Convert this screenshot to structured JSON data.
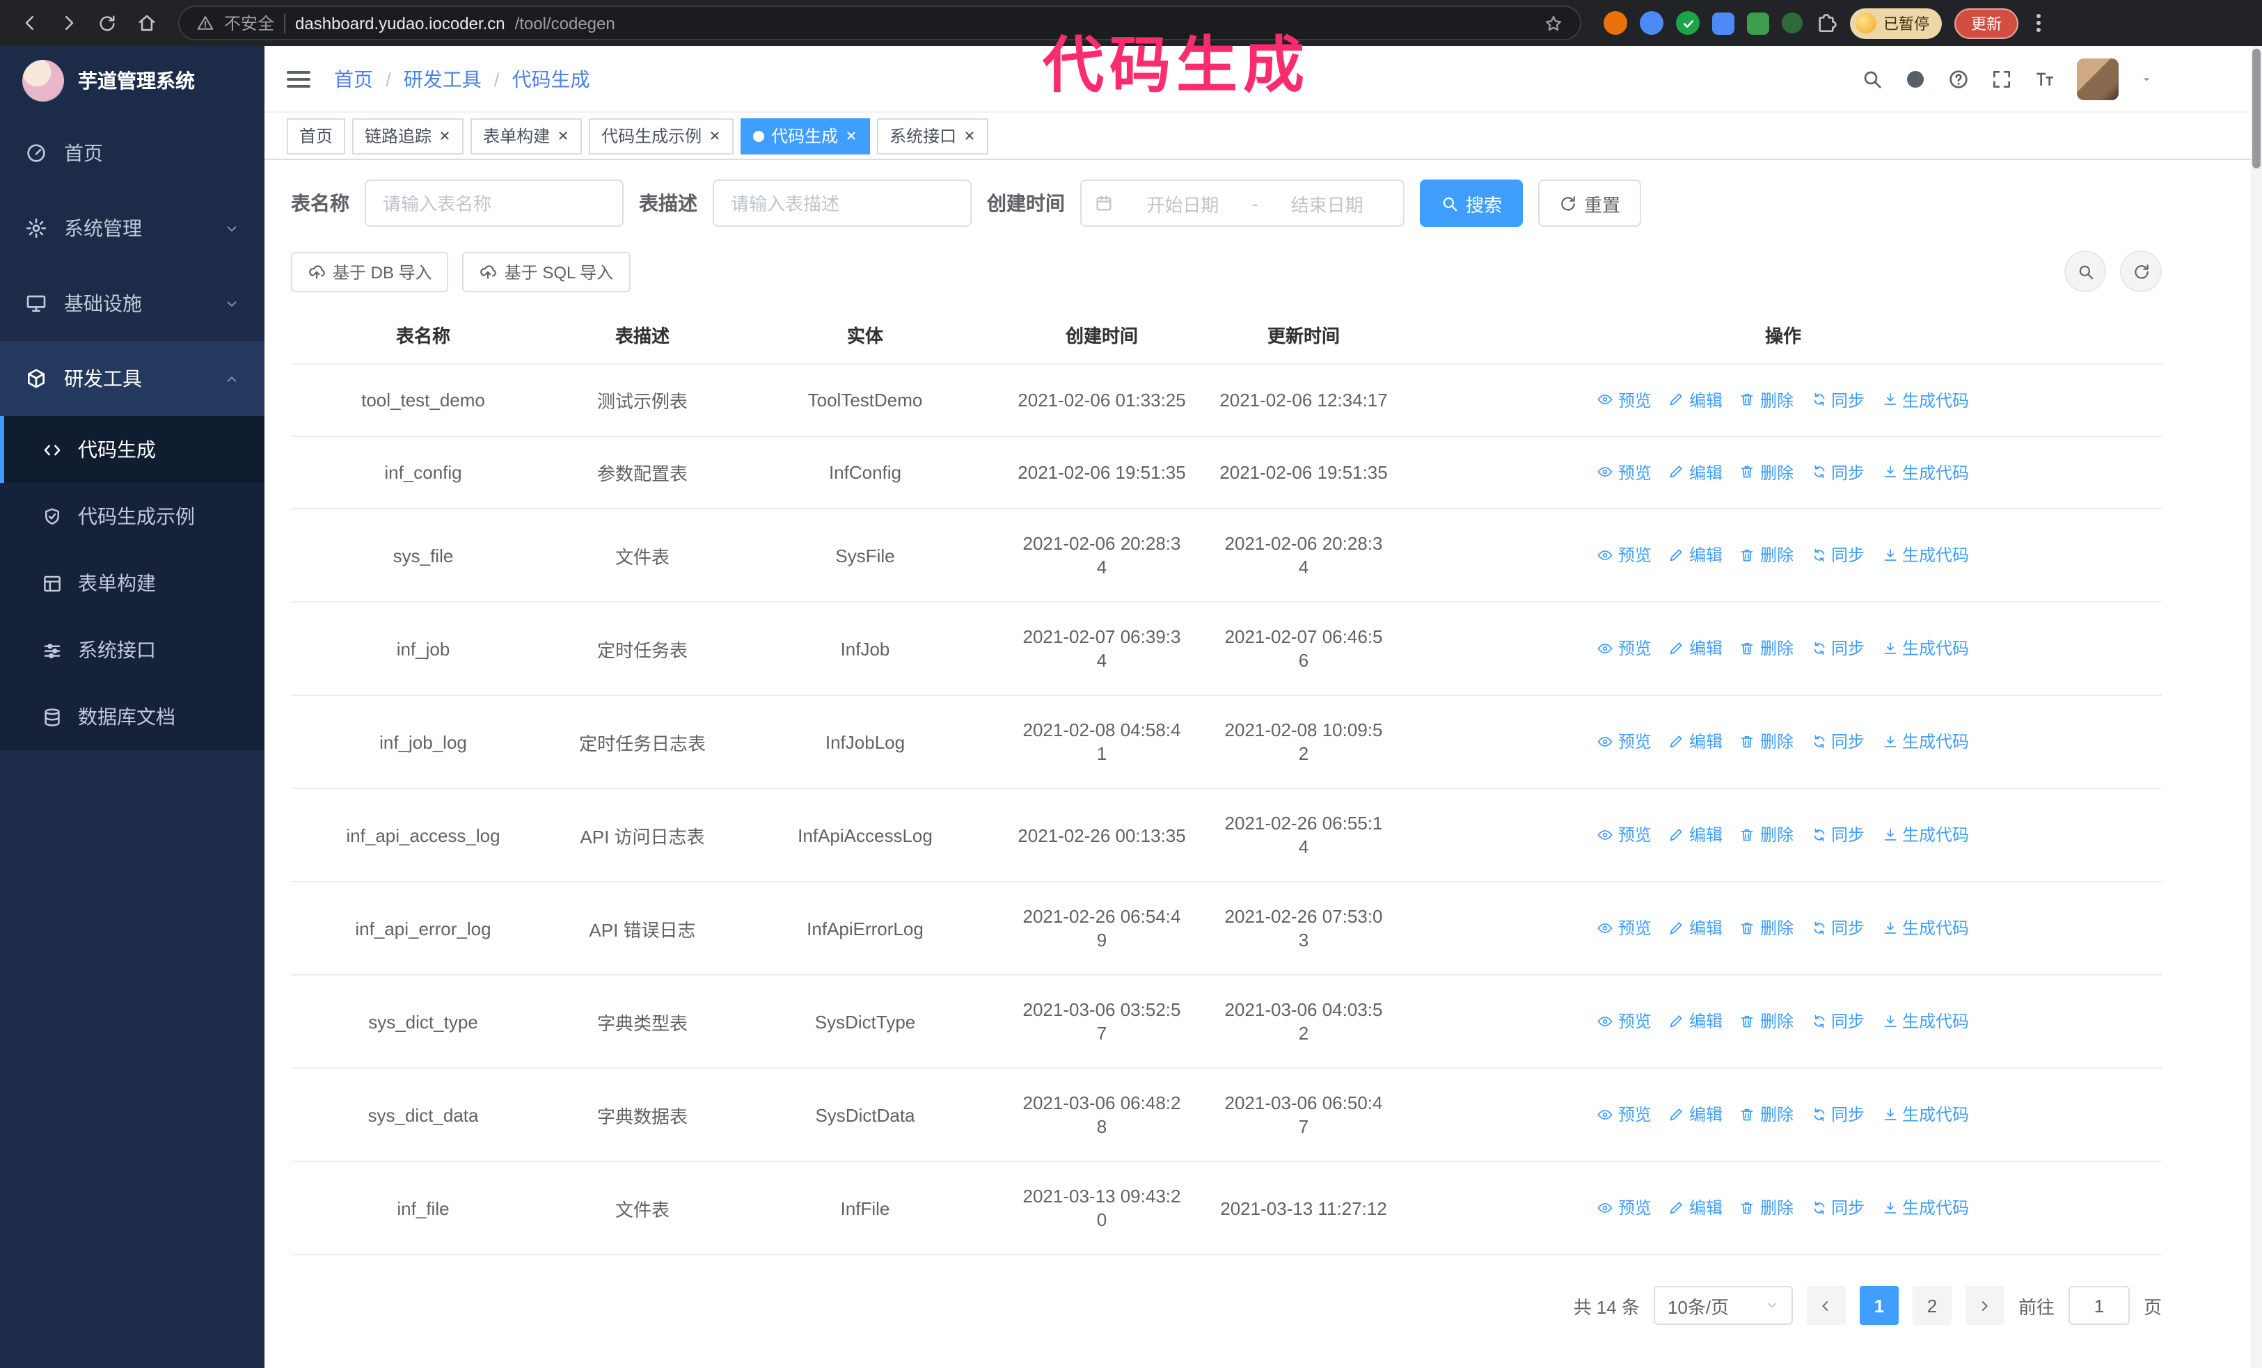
{
  "browser": {
    "security_label": "不安全",
    "url_host": "dashboard.yudao.iocoder.cn",
    "url_path": "/tool/codegen",
    "profile_chip": "已暂停",
    "update_button": "更新"
  },
  "annotation": {
    "text": "代码生成"
  },
  "colors": {
    "accent": "#409eff",
    "annotation_pink": "#fa2c6e",
    "sidebar_bg": "#1c2b48",
    "active_tab": "#409eff"
  },
  "sidebar": {
    "title": "芋道管理系统",
    "items": [
      {
        "label": "首页"
      },
      {
        "label": "系统管理"
      },
      {
        "label": "基础设施"
      },
      {
        "label": "研发工具"
      }
    ],
    "subitems": [
      {
        "label": "代码生成"
      },
      {
        "label": "代码生成示例"
      },
      {
        "label": "表单构建"
      },
      {
        "label": "系统接口"
      },
      {
        "label": "数据库文档"
      }
    ]
  },
  "header": {
    "breadcrumb": [
      "首页",
      "研发工具",
      "代码生成"
    ],
    "separator": "/"
  },
  "tabs": [
    {
      "label": "首页",
      "active": false,
      "closable": false
    },
    {
      "label": "链路追踪",
      "active": false,
      "closable": true
    },
    {
      "label": "表单构建",
      "active": false,
      "closable": true
    },
    {
      "label": "代码生成示例",
      "active": false,
      "closable": true
    },
    {
      "label": "代码生成",
      "active": true,
      "closable": true
    },
    {
      "label": "系统接口",
      "active": false,
      "closable": true
    }
  ],
  "filters": {
    "table_name_label": "表名称",
    "table_name_placeholder": "请输入表名称",
    "table_desc_label": "表描述",
    "table_desc_placeholder": "请输入表描述",
    "create_time_label": "创建时间",
    "start_date_placeholder": "开始日期",
    "range_separator": "-",
    "end_date_placeholder": "结束日期",
    "search_button": "搜索",
    "reset_button": "重置"
  },
  "toolbar": {
    "import_db": "基于 DB 导入",
    "import_sql": "基于 SQL 导入"
  },
  "table": {
    "columns": [
      "表名称",
      "表描述",
      "实体",
      "创建时间",
      "更新时间",
      "操作"
    ],
    "actions": [
      "预览",
      "编辑",
      "删除",
      "同步",
      "生成代码"
    ],
    "rows": [
      {
        "name": "tool_test_demo",
        "desc": "测试示例表",
        "entity": "ToolTestDemo",
        "created": "2021-02-06 01:33:25",
        "updated": "2021-02-06 12:34:17"
      },
      {
        "name": "inf_config",
        "desc": "参数配置表",
        "entity": "InfConfig",
        "created": "2021-02-06 19:51:35",
        "updated": "2021-02-06 19:51:35"
      },
      {
        "name": "sys_file",
        "desc": "文件表",
        "entity": "SysFile",
        "created": "2021-02-06 20:28:3\n4",
        "updated": "2021-02-06 20:28:3\n4"
      },
      {
        "name": "inf_job",
        "desc": "定时任务表",
        "entity": "InfJob",
        "created": "2021-02-07 06:39:3\n4",
        "updated": "2021-02-07 06:46:5\n6"
      },
      {
        "name": "inf_job_log",
        "desc": "定时任务日志表",
        "entity": "InfJobLog",
        "created": "2021-02-08 04:58:4\n1",
        "updated": "2021-02-08 10:09:5\n2"
      },
      {
        "name": "inf_api_access_log",
        "desc": "API 访问日志表",
        "entity": "InfApiAccessLog",
        "created": "2021-02-26 00:13:35",
        "updated": "2021-02-26 06:55:1\n4"
      },
      {
        "name": "inf_api_error_log",
        "desc": "API 错误日志",
        "entity": "InfApiErrorLog",
        "created": "2021-02-26 06:54:4\n9",
        "updated": "2021-02-26 07:53:0\n3"
      },
      {
        "name": "sys_dict_type",
        "desc": "字典类型表",
        "entity": "SysDictType",
        "created": "2021-03-06 03:52:5\n7",
        "updated": "2021-03-06 04:03:5\n2"
      },
      {
        "name": "sys_dict_data",
        "desc": "字典数据表",
        "entity": "SysDictData",
        "created": "2021-03-06 06:48:2\n8",
        "updated": "2021-03-06 06:50:4\n7"
      },
      {
        "name": "inf_file",
        "desc": "文件表",
        "entity": "InfFile",
        "created": "2021-03-13 09:43:2\n0",
        "updated": "2021-03-13 11:27:12"
      }
    ]
  },
  "pagination": {
    "total": "共 14 条",
    "page_size": "10条/页",
    "pages": [
      "1",
      "2"
    ],
    "goto_label": "前往",
    "goto_value": "1",
    "goto_unit": "页"
  }
}
